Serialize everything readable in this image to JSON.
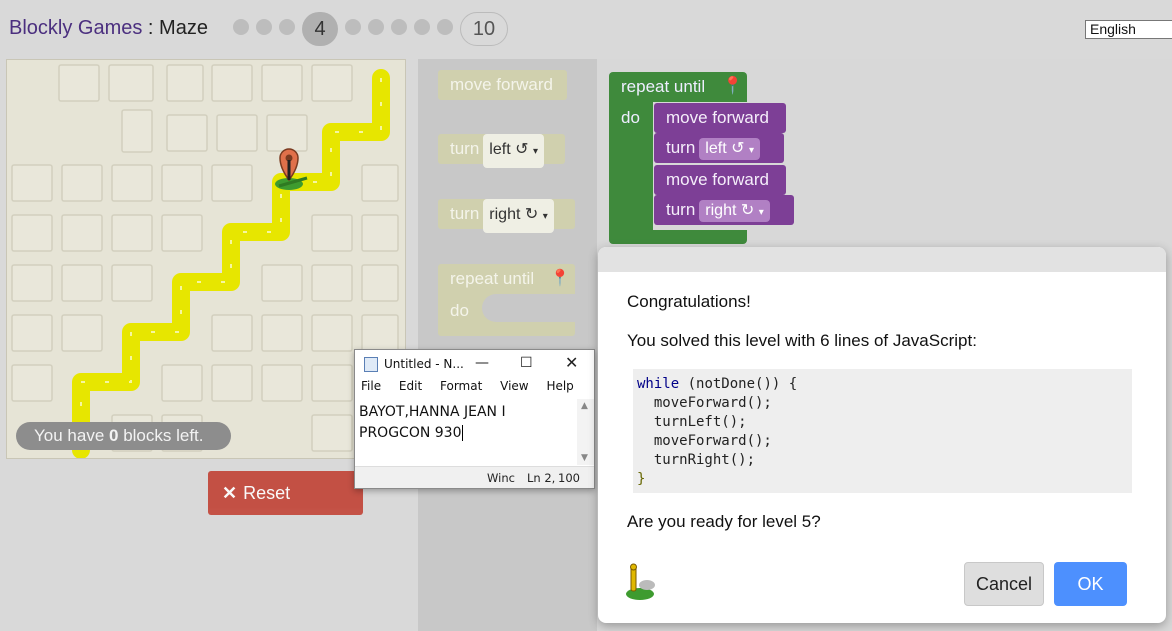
{
  "header": {
    "brand": "Blockly Games",
    "separator": " : ",
    "game": "Maze",
    "current_level": "4",
    "last_level": "10",
    "language": "English"
  },
  "maze": {
    "blocks_left_prefix": "You have ",
    "blocks_left_count": "0",
    "blocks_left_suffix": " blocks left.",
    "reset_label": "Reset"
  },
  "toolbox": {
    "move_forward": "move forward",
    "turn": "turn",
    "left": "left ↺",
    "right": "right ↻",
    "repeat_until": "repeat until",
    "do": "do"
  },
  "workspace": {
    "repeat_until": "repeat until",
    "do": "do",
    "move_forward_1": "move forward",
    "turn_1": "turn",
    "turn_1_dir": "left ↺",
    "move_forward_2": "move forward",
    "turn_2": "turn",
    "turn_2_dir": "right ↻"
  },
  "notepad": {
    "title": "Untitled - N...",
    "menu": [
      "File",
      "Edit",
      "Format",
      "View",
      "Help"
    ],
    "line1": "BAYOT,HANNA JEAN I",
    "line2": "PROGCON 930",
    "status_enc": "Winc",
    "status_pos": "Ln 2,",
    "status_zoom": "100"
  },
  "dialog": {
    "congrats": "Congratulations!",
    "solved": "You solved this level with 6 lines of JavaScript:",
    "code": {
      "l1_kw": "while",
      "l1_rest": " (notDone()) {",
      "l2": "  moveForward();",
      "l3": "  turnLeft();",
      "l4": "  moveForward();",
      "l5": "  turnRight();",
      "l6": "}"
    },
    "question": "Are you ready for level 5?",
    "cancel": "Cancel",
    "ok": "OK"
  },
  "colors": {
    "accent": "#4d90fe",
    "path": "#e7e600",
    "brand": "#4b2f7f",
    "loop_green": "#3f8a3c",
    "action_purple": "#7d3f96"
  }
}
